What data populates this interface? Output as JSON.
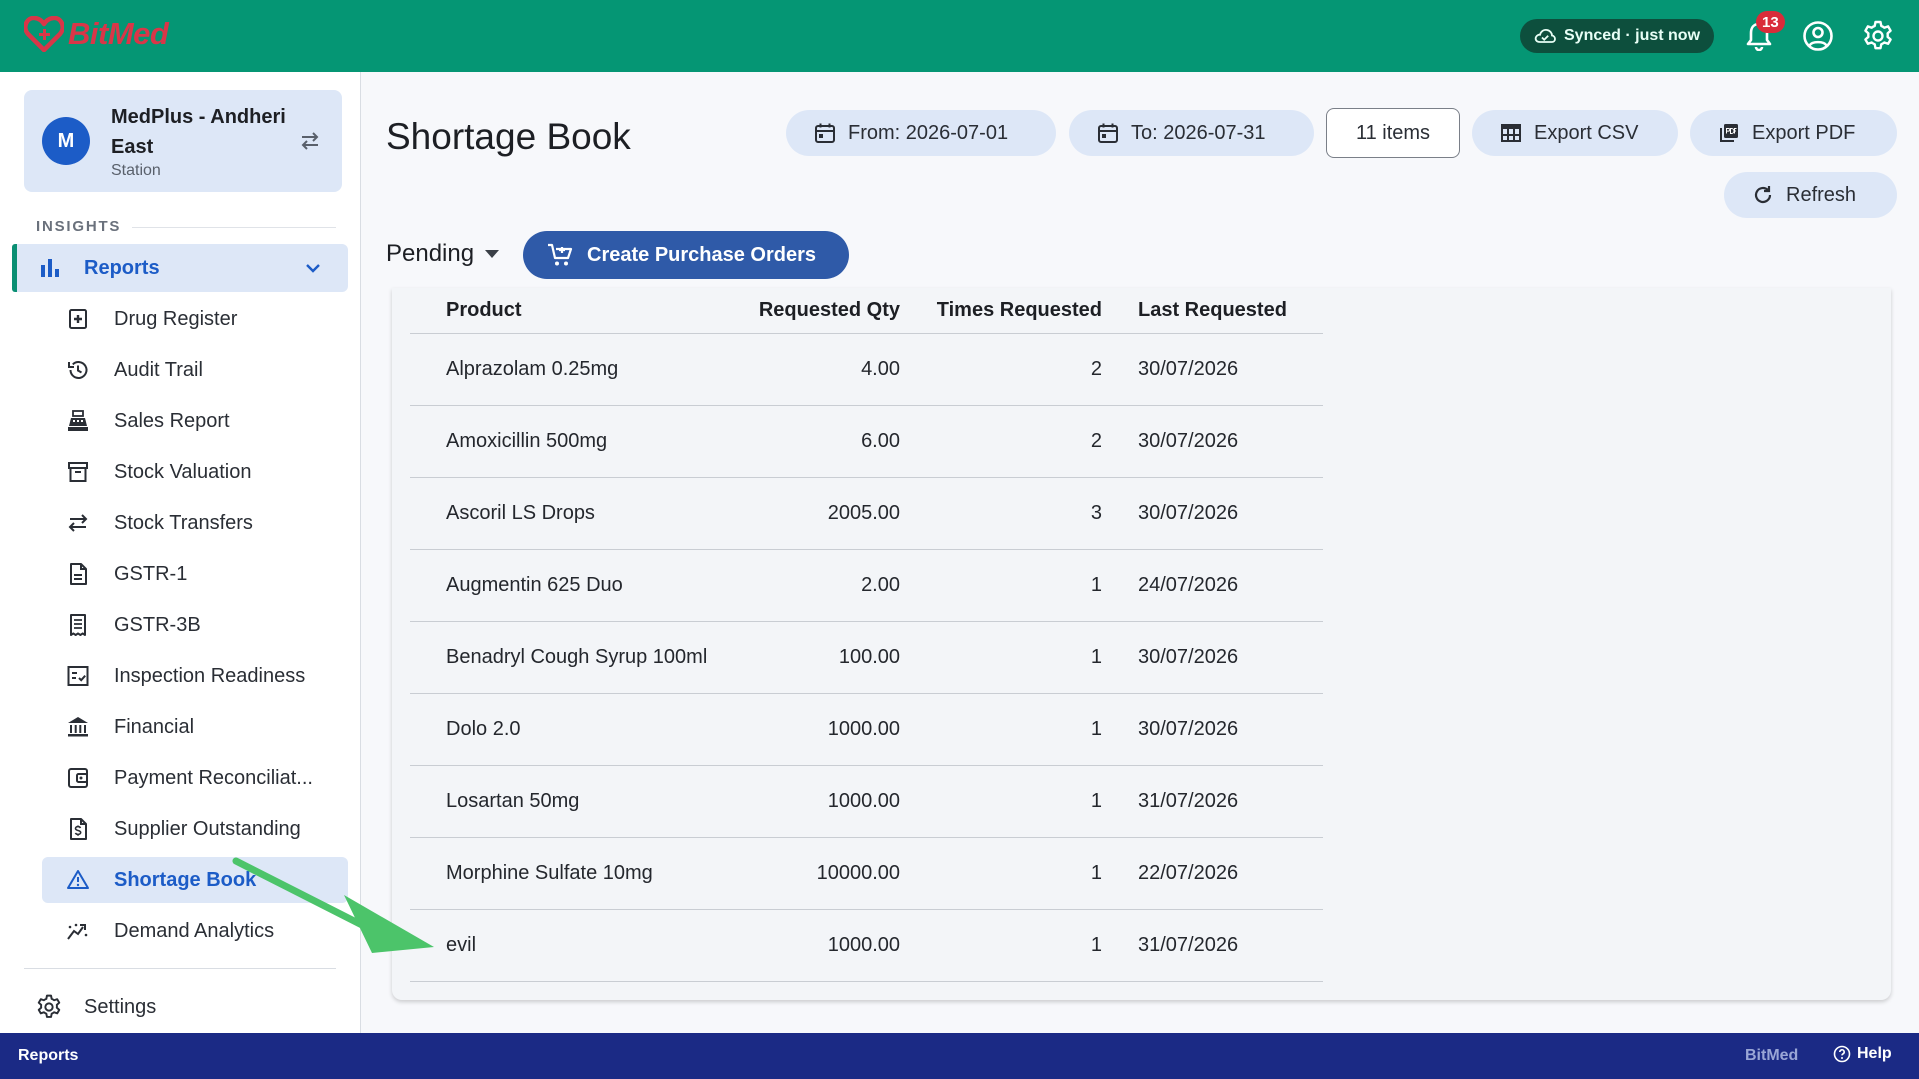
{
  "brand": {
    "name": "BitMed"
  },
  "topbar": {
    "sync_status": "Synced · just now",
    "notifications_count": "13"
  },
  "store": {
    "initial": "M",
    "name": "MedPlus - Andheri East",
    "subtitle": "Station"
  },
  "sidebar": {
    "section_title": "INSIGHTS",
    "parent": {
      "label": "Reports"
    },
    "items": [
      {
        "label": "Drug Register",
        "icon": "medical-box-icon"
      },
      {
        "label": "Audit Trail",
        "icon": "history-icon"
      },
      {
        "label": "Sales Report",
        "icon": "cash-register-icon"
      },
      {
        "label": "Stock Valuation",
        "icon": "archive-box-icon"
      },
      {
        "label": "Stock Transfers",
        "icon": "transfer-arrows-icon"
      },
      {
        "label": "GSTR-1",
        "icon": "document-icon"
      },
      {
        "label": "GSTR-3B",
        "icon": "receipt-icon"
      },
      {
        "label": "Inspection Readiness",
        "icon": "checklist-icon"
      },
      {
        "label": "Financial",
        "icon": "bank-icon"
      },
      {
        "label": "Payment Reconciliat...",
        "icon": "wallet-icon"
      },
      {
        "label": "Supplier Outstanding",
        "icon": "invoice-dollar-icon"
      },
      {
        "label": "Shortage Book",
        "icon": "warning-triangle-icon",
        "active": true
      },
      {
        "label": "Demand Analytics",
        "icon": "trend-chart-icon"
      }
    ],
    "settings_label": "Settings"
  },
  "main": {
    "title": "Shortage Book",
    "from_date": "From: 2026-07-01",
    "to_date": "To: 2026-07-31",
    "items_count": "11 items",
    "export_csv": "Export CSV",
    "export_pdf": "Export PDF",
    "refresh": "Refresh",
    "status_filter": "Pending",
    "create_po": "Create Purchase Orders"
  },
  "table": {
    "headers": {
      "product": "Product",
      "qty": "Requested Qty",
      "times": "Times Requested",
      "last": "Last Requested"
    },
    "rows": [
      {
        "product": "Alprazolam 0.25mg",
        "qty": "4.00",
        "times": "2",
        "last": "30/07/2026"
      },
      {
        "product": "Amoxicillin 500mg",
        "qty": "6.00",
        "times": "2",
        "last": "30/07/2026"
      },
      {
        "product": "Ascoril LS Drops",
        "qty": "2005.00",
        "times": "3",
        "last": "30/07/2026"
      },
      {
        "product": "Augmentin 625 Duo",
        "qty": "2.00",
        "times": "1",
        "last": "24/07/2026"
      },
      {
        "product": "Benadryl Cough Syrup 100ml",
        "qty": "100.00",
        "times": "1",
        "last": "30/07/2026"
      },
      {
        "product": "Dolo 2.0",
        "qty": "1000.00",
        "times": "1",
        "last": "30/07/2026"
      },
      {
        "product": "Losartan 50mg",
        "qty": "1000.00",
        "times": "1",
        "last": "31/07/2026"
      },
      {
        "product": "Morphine Sulfate 10mg",
        "qty": "10000.00",
        "times": "1",
        "last": "22/07/2026"
      },
      {
        "product": "evil",
        "qty": "1000.00",
        "times": "1",
        "last": "31/07/2026"
      }
    ]
  },
  "footer": {
    "section": "Reports",
    "brand": "BitMed",
    "help": "Help"
  },
  "colors": {
    "topbar": "#059674",
    "accent": "#1c5cc7",
    "primary_button": "#2f5aa8",
    "footer": "#1b2a85",
    "badge": "#d92c3a",
    "arrow": "#4cc46a"
  }
}
